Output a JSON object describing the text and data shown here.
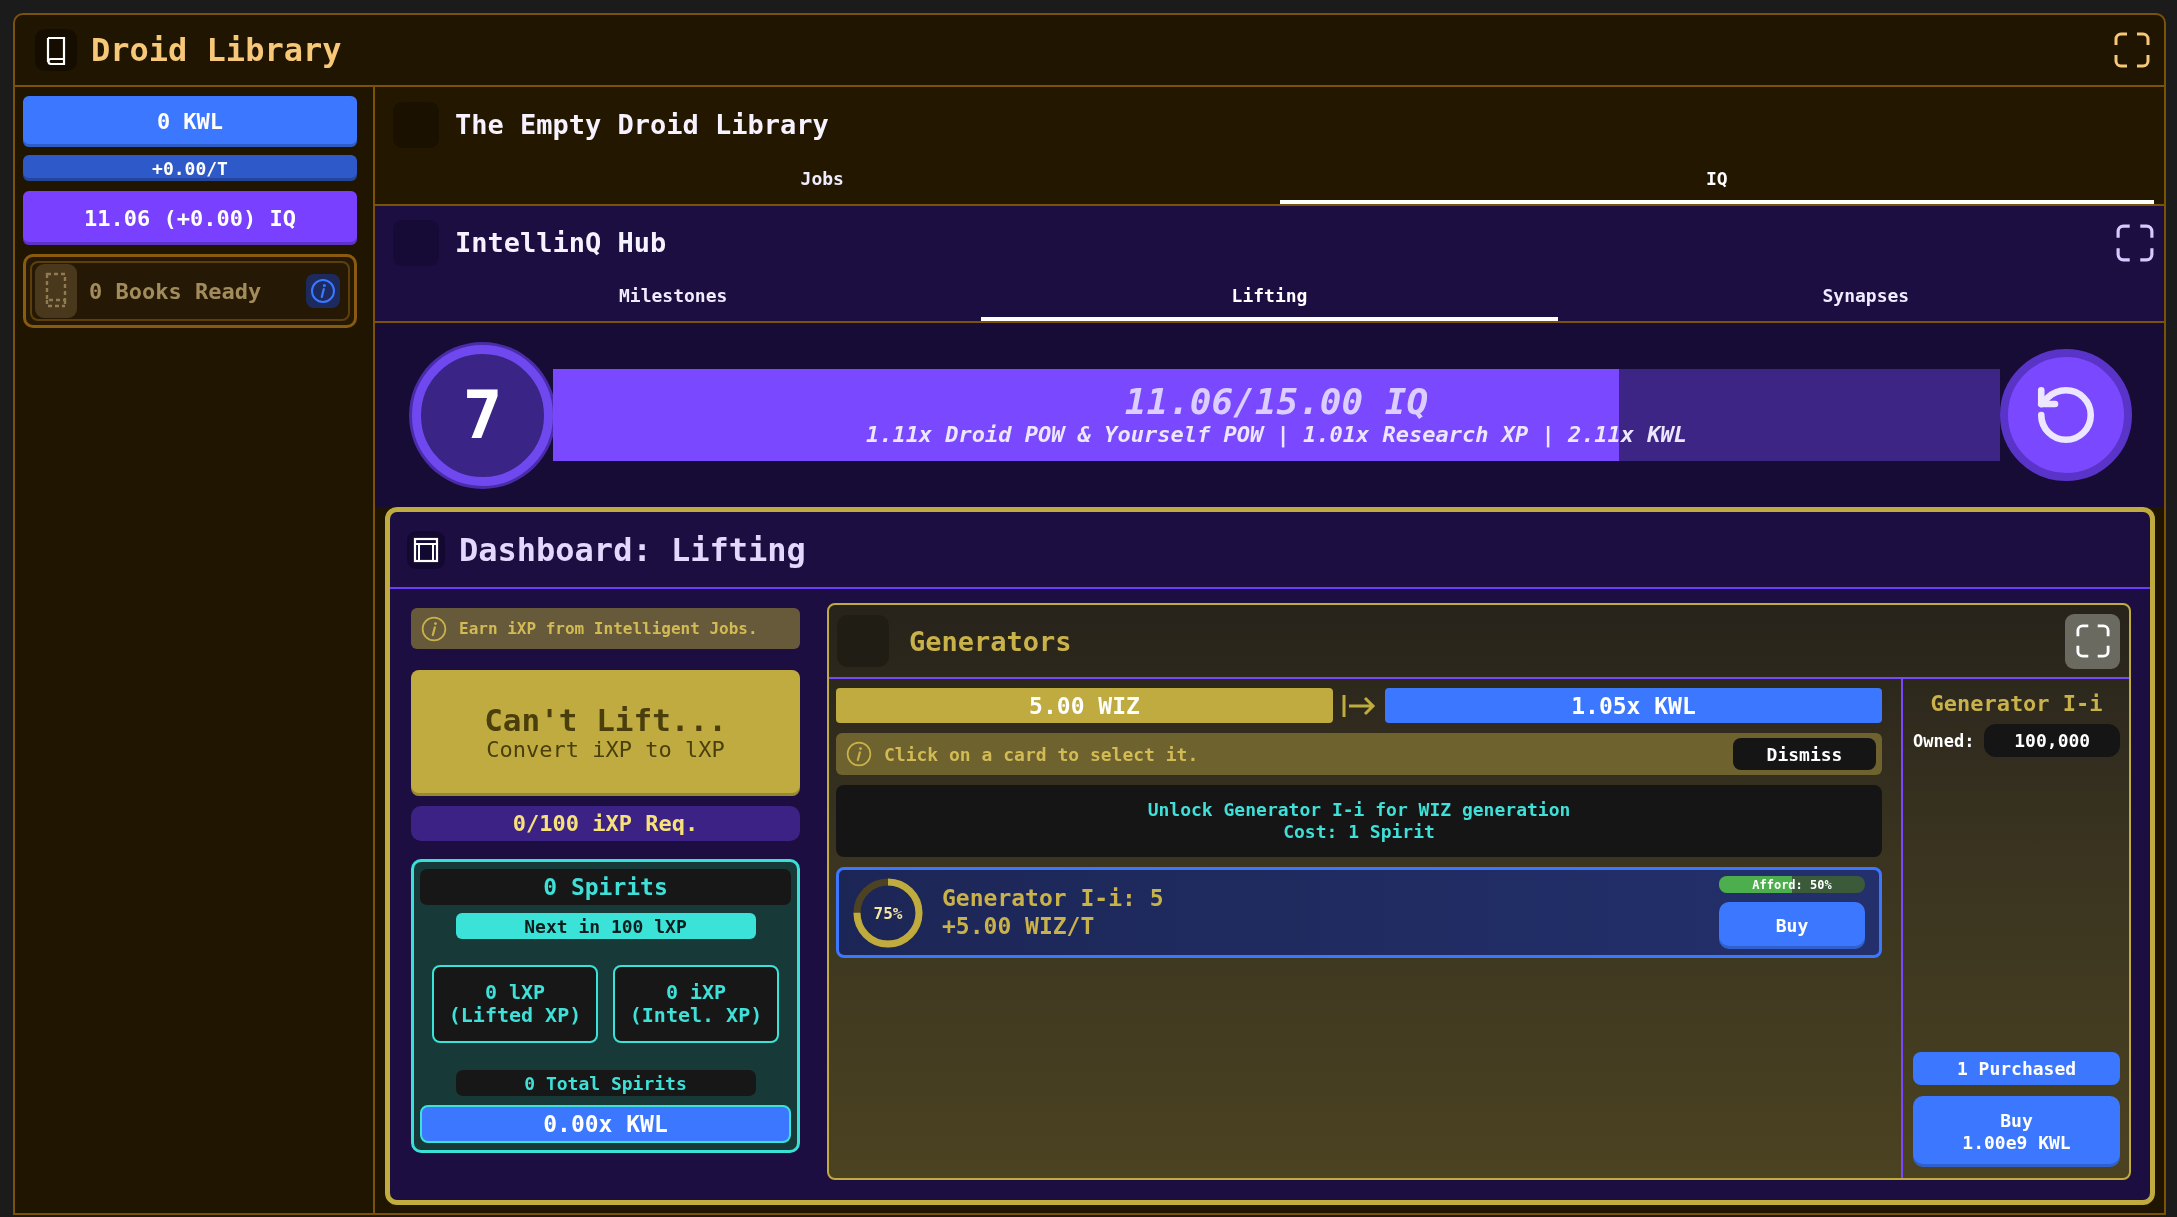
{
  "app": {
    "title": "Droid Library"
  },
  "sidebar": {
    "kwl": "0 KWL",
    "kwl_rate": "+0.00/T",
    "iq": "11.06 (+0.00) IQ",
    "books": "0 Books Ready"
  },
  "library": {
    "title": "The Empty Droid Library",
    "tabs": [
      {
        "label": "Jobs",
        "selected": false
      },
      {
        "label": "IQ",
        "selected": true
      }
    ]
  },
  "hub": {
    "title": "IntellinQ Hub",
    "tabs": [
      {
        "label": "Milestones",
        "selected": false
      },
      {
        "label": "Lifting",
        "selected": true
      },
      {
        "label": "Synapses",
        "selected": false
      }
    ]
  },
  "iq_progress": {
    "badge": "7",
    "reading": "11.06/15.00 IQ",
    "bonuses": "1.11x Droid POW & Yourself POW | 1.01x Research XP | 2.11x KWL",
    "level": 0.737
  },
  "dashboard": {
    "title": "Dashboard: Lifting",
    "hint": "Earn iXP from Intelligent Jobs.",
    "lift_button": {
      "label": "Can't Lift...",
      "sublabel": "Convert iXP to lXP"
    },
    "requirement": "0/100 iXP Req.",
    "spirits": {
      "count": "0 Spirits",
      "next": "Next in 100 lXP",
      "stats": [
        {
          "value": "0 lXP",
          "label": "(Lifted XP)"
        },
        {
          "value": "0 iXP",
          "label": "(Intel. XP)"
        }
      ],
      "total": "0 Total Spirits",
      "multiplier": "0.00x KWL"
    },
    "generators": {
      "title": "Generators",
      "conversion": {
        "from": "5.00 WIZ",
        "to": "1.05x KWL"
      },
      "hint": "Click on a card to select it.",
      "dismiss": "Dismiss",
      "unlock": [
        "Unlock Generator I-i for WIZ generation",
        "Cost: 1 Spirit"
      ],
      "cards": [
        {
          "selected": true,
          "progress": {
            "label": "75%",
            "level": 0.75
          },
          "name": "Generator I-i: 5",
          "rate": "+5.00 WIZ/T",
          "afford": {
            "label": "Afford: 50%",
            "level": 0.5
          },
          "buy": "Buy"
        }
      ],
      "detail": {
        "title": "Generator I-i",
        "owned_label": "Owned:",
        "owned": "100,000",
        "purchased": "1 Purchased",
        "buy": {
          "label": "Buy",
          "price": "1.00e9 KWL"
        }
      }
    }
  }
}
